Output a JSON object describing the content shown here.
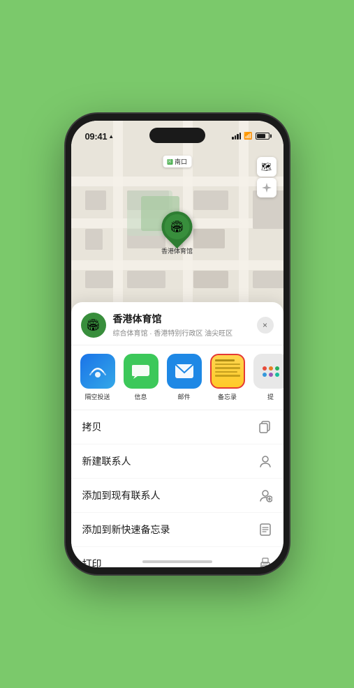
{
  "status_bar": {
    "time": "09:41",
    "location_arrow": "▲"
  },
  "map": {
    "label": "南口",
    "venue_name_pin": "香港体育馆",
    "controls": {
      "map_type": "🗺",
      "location": "➤"
    }
  },
  "bottom_sheet": {
    "venue_name": "香港体育馆",
    "venue_subtitle": "综合体育馆 · 香港特别行政区 油尖旺区",
    "close_label": "×",
    "share_items": [
      {
        "id": "airdrop",
        "label": "隔空投送",
        "type": "airdrop"
      },
      {
        "id": "messages",
        "label": "信息",
        "type": "messages"
      },
      {
        "id": "mail",
        "label": "邮件",
        "type": "mail"
      },
      {
        "id": "notes",
        "label": "备忘录",
        "type": "notes"
      },
      {
        "id": "more",
        "label": "提",
        "type": "more"
      }
    ],
    "actions": [
      {
        "id": "copy",
        "label": "拷贝",
        "icon": "⎘"
      },
      {
        "id": "new-contact",
        "label": "新建联系人",
        "icon": "👤"
      },
      {
        "id": "add-existing",
        "label": "添加到现有联系人",
        "icon": "👤"
      },
      {
        "id": "add-notes",
        "label": "添加到新快速备忘录",
        "icon": "📋"
      },
      {
        "id": "print",
        "label": "打印",
        "icon": "🖨"
      }
    ]
  }
}
